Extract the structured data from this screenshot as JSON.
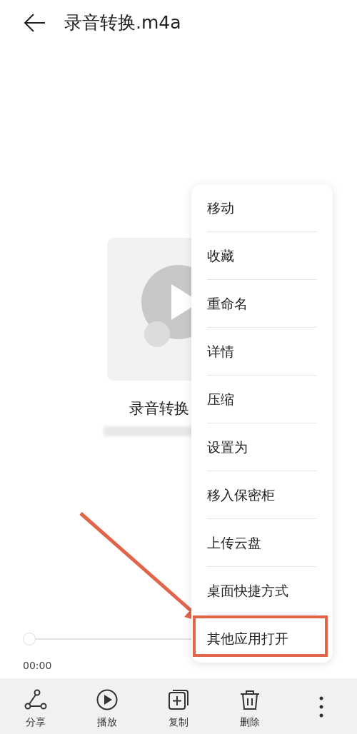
{
  "header": {
    "title": "录音转换.m4a"
  },
  "file": {
    "name": "录音转换"
  },
  "player": {
    "level": 0,
    "elapsed": "00:00"
  },
  "menu": [
    {
      "label": "移动",
      "highlighted": false
    },
    {
      "label": "收藏",
      "highlighted": false
    },
    {
      "label": "重命名",
      "highlighted": false
    },
    {
      "label": "详情",
      "highlighted": false
    },
    {
      "label": "压缩",
      "highlighted": false
    },
    {
      "label": "设置为",
      "highlighted": false
    },
    {
      "label": "移入保密柜",
      "highlighted": false
    },
    {
      "label": "上传云盘",
      "highlighted": false
    },
    {
      "label": "桌面快捷方式",
      "highlighted": false
    },
    {
      "label": "其他应用打开",
      "highlighted": true
    }
  ],
  "toolbar": [
    {
      "kind": "share",
      "label": "分享"
    },
    {
      "kind": "play",
      "label": "播放"
    },
    {
      "kind": "copy",
      "label": "复制"
    },
    {
      "kind": "delete",
      "label": "删除"
    },
    {
      "kind": "more"
    }
  ]
}
